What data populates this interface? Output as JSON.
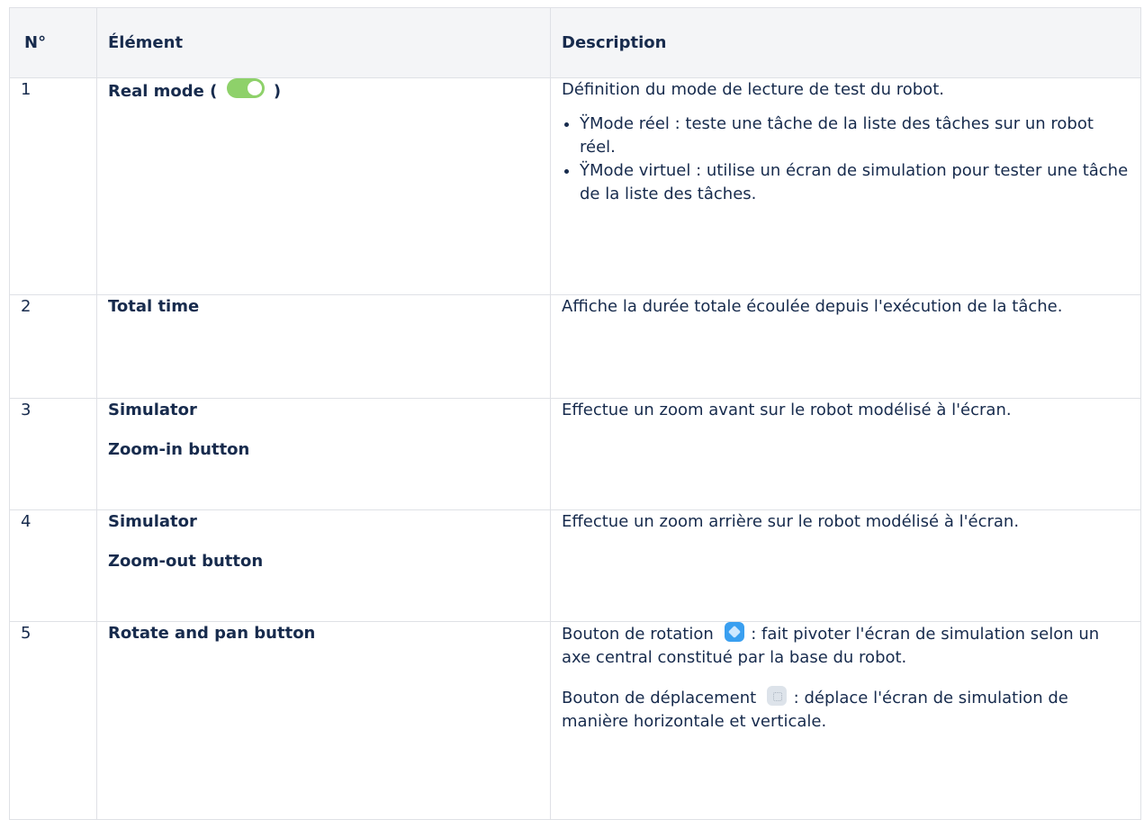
{
  "headers": {
    "num": "N°",
    "element": "Élément",
    "description": "Description"
  },
  "rows": [
    {
      "num": "1",
      "element_lines": [
        "Real mode ("
      ],
      "element_suffix": ")",
      "description": {
        "intro": "Définition du mode de lecture de test du robot.",
        "bullets": [
          "ŸMode réel : teste une tâche de la liste des tâches sur un robot réel.",
          "ŸMode virtuel : utilise un écran de simulation pour tester une tâche de la liste des tâches."
        ]
      }
    },
    {
      "num": "2",
      "element_lines": [
        "Total time"
      ],
      "description": {
        "intro": "Affiche la durée totale écoulée depuis l'exécution de la tâche."
      }
    },
    {
      "num": "3",
      "element_lines": [
        "Simulator",
        "Zoom-in button"
      ],
      "description": {
        "intro": "Effectue un zoom avant sur le robot modélisé à l'écran."
      }
    },
    {
      "num": "4",
      "element_lines": [
        "Simulator",
        "Zoom-out button"
      ],
      "description": {
        "intro": "Effectue un zoom arrière sur le robot modélisé à l'écran."
      }
    },
    {
      "num": "5",
      "element_lines": [
        "Rotate and pan button"
      ],
      "description": {
        "rotate_prefix": "Bouton de rotation",
        "rotate_text": ": fait pivoter l'écran de simulation selon un axe central constitué par la base du robot.",
        "pan_prefix": "Bouton de déplacement",
        "pan_text": ": déplace l'écran de simulation de manière horizontale et verticale."
      }
    }
  ],
  "icons": {
    "toggle": "toggle-on-icon",
    "rotate": "rotate-icon",
    "pan": "pan-icon"
  },
  "colors": {
    "header_bg": "#f4f5f7",
    "border": "#dfe1e6",
    "text": "#172b4d",
    "toggle_on": "#8ed16a",
    "rotate_icon": "#3a9ff0"
  }
}
